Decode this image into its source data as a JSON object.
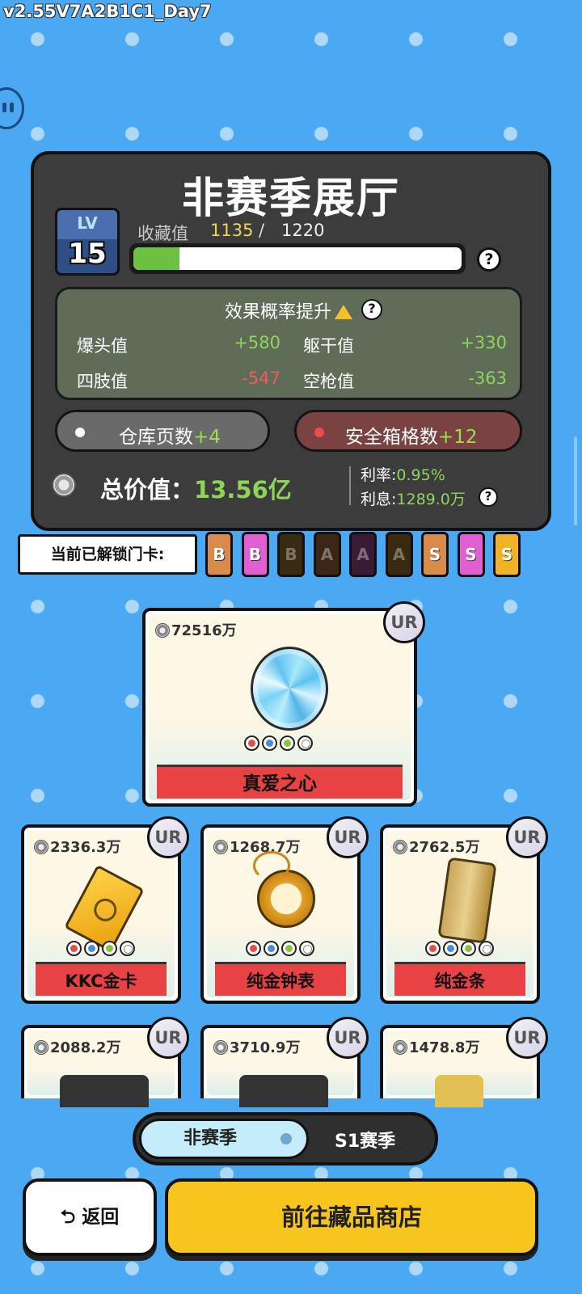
{
  "version": "v2.55V7A2B1C1_Day7",
  "hall": {
    "title": "非赛季展厅",
    "level_label": "LV",
    "level": "15",
    "collection_label": "收藏值",
    "collection_current": "1135",
    "collection_sep": "/",
    "collection_max": "1220",
    "collection_progress": 0.14,
    "effect": {
      "title": "效果概率提升",
      "stats": [
        {
          "label": "爆头值",
          "value": "+580",
          "tone": "pos"
        },
        {
          "label": "躯干值",
          "value": "+330",
          "tone": "pos"
        },
        {
          "label": "四肢值",
          "value": "-547",
          "tone": "neg"
        },
        {
          "label": "空枪值",
          "value": "-363",
          "tone": "pos"
        }
      ]
    },
    "warehouse": {
      "label": "仓库页数",
      "bonus": "+4"
    },
    "safebox": {
      "label": "安全箱格数",
      "bonus": "+12"
    },
    "total_label": "总价值：",
    "total_value": "13.56亿",
    "rate_label": "利率:",
    "rate_value": "0.95%",
    "interest_label": "利息:",
    "interest_value": "1289.0万"
  },
  "keycards": {
    "label": "当前已解锁门卡:",
    "cards": [
      {
        "letter": "B",
        "color": "#d98b4a",
        "unlocked": true
      },
      {
        "letter": "B",
        "color": "#e25fd3",
        "unlocked": true
      },
      {
        "letter": "B",
        "color": "#3a2a12",
        "unlocked": false
      },
      {
        "letter": "A",
        "color": "#3b2616",
        "unlocked": false
      },
      {
        "letter": "A",
        "color": "#3b1a36",
        "unlocked": false
      },
      {
        "letter": "A",
        "color": "#3a2a12",
        "unlocked": false
      },
      {
        "letter": "S",
        "color": "#d98b4a",
        "unlocked": true
      },
      {
        "letter": "S",
        "color": "#e25fd3",
        "unlocked": true
      },
      {
        "letter": "S",
        "color": "#f0b324",
        "unlocked": true
      }
    ]
  },
  "featured": {
    "price": "72516万",
    "rarity": "UR",
    "name": "真爱之心"
  },
  "items": [
    {
      "price": "2336.3万",
      "rarity": "UR",
      "name": "KKC金卡",
      "icon": "gold-card-icon"
    },
    {
      "price": "1268.7万",
      "rarity": "UR",
      "name": "纯金钟表",
      "icon": "gold-watch-icon"
    },
    {
      "price": "2762.5万",
      "rarity": "UR",
      "name": "纯金条",
      "icon": "gold-bar-icon"
    },
    {
      "price": "2088.2万",
      "rarity": "UR",
      "icon": "graphics-card-icon"
    },
    {
      "price": "3710.9万",
      "rarity": "UR",
      "icon": "camera-icon"
    },
    {
      "price": "1478.8万",
      "rarity": "UR",
      "icon": "golden-deer-icon"
    }
  ],
  "season": {
    "off_season": "非赛季",
    "s1": "S1赛季"
  },
  "buttons": {
    "back": "返回",
    "shop": "前往藏品商店"
  }
}
